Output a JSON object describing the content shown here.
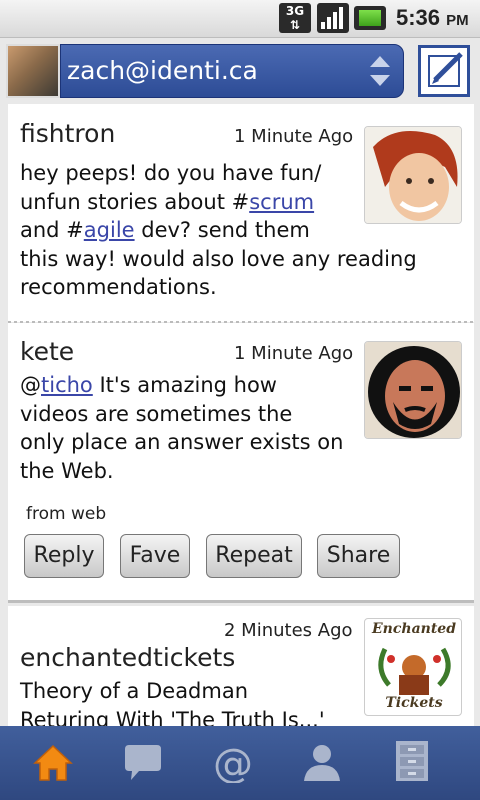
{
  "status_bar": {
    "network": "3G",
    "time": "5:36",
    "ampm": "PM"
  },
  "header": {
    "account": "zach@identi.ca"
  },
  "notices": [
    {
      "author": "fishtron",
      "time": "1 Minute Ago",
      "lines": [
        "hey peeps! do you have fun/",
        "unfun stories about #",
        "scrum",
        "and #",
        "agile",
        " dev? send them",
        "this way! would also love any reading",
        "recommendations."
      ]
    },
    {
      "author": "kete",
      "time": "1 Minute Ago",
      "mention_at": "@",
      "mention": "ticho",
      "line1_rest": " It's amazing how",
      "lines": [
        "videos are sometimes the",
        "only place an answer exists on",
        "the Web."
      ],
      "source": "from web",
      "actions": [
        "Reply",
        "Fave",
        "Repeat",
        "Share"
      ]
    },
    {
      "author": "enchantedtickets",
      "time": "2 Minutes Ago",
      "lines": [
        "Theory of a Deadman",
        "Returing With 'The Truth Is...'"
      ],
      "image_text": [
        "Enchanted",
        "Tickets"
      ]
    }
  ],
  "tabs": [
    {
      "name": "home",
      "icon": "home-icon",
      "active": true
    },
    {
      "name": "messages",
      "icon": "chat-bubble-icon",
      "active": false
    },
    {
      "name": "replies",
      "icon": "at-sign-icon",
      "active": false
    },
    {
      "name": "profile",
      "icon": "person-icon",
      "active": false
    },
    {
      "name": "favorites",
      "icon": "file-cabinet-icon",
      "active": false
    }
  ],
  "colors": {
    "header_blue": "#2d4c96",
    "link": "#3a46a8",
    "home_active": "#f28a12",
    "tab_icon": "#aab5cc"
  }
}
